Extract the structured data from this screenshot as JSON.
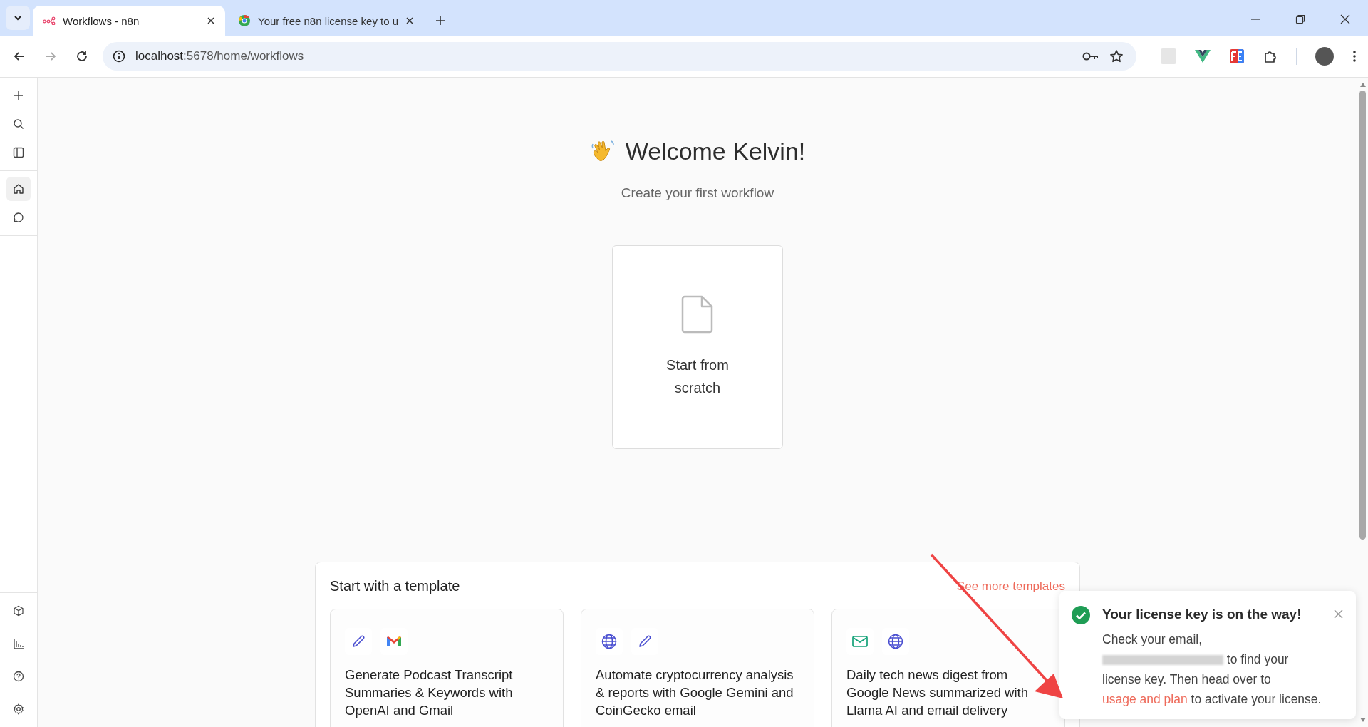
{
  "browser": {
    "tabs": [
      {
        "title": "Workflows - n8n",
        "selected": true,
        "kind": "n8n"
      },
      {
        "title": "Your free n8n license key to u",
        "selected": false,
        "kind": "chrome"
      }
    ],
    "address": "localhost:5678/home/workflows"
  },
  "sidebar": {
    "top": [
      {
        "kind": "plus",
        "selected": false
      },
      {
        "kind": "search",
        "selected": false
      },
      {
        "kind": "panel",
        "selected": false
      }
    ],
    "middle": [
      {
        "kind": "home",
        "selected": true
      },
      {
        "kind": "chat",
        "selected": false
      }
    ],
    "bottom": [
      {
        "kind": "box",
        "selected": false
      },
      {
        "kind": "chart",
        "selected": false
      },
      {
        "kind": "help",
        "selected": false
      },
      {
        "kind": "settings",
        "selected": false
      }
    ]
  },
  "welcome": {
    "title": "Welcome Kelvin!",
    "subtitle": "Create your first workflow"
  },
  "start_card": {
    "label": "Start from scratch"
  },
  "templates": {
    "heading": "Start with a template",
    "link": "See more templates",
    "cards": [
      {
        "icons": [
          {
            "kind": "pencil"
          },
          {
            "kind": "gmail"
          }
        ],
        "title": "Generate Podcast Transcript Summaries & Keywords with OpenAI and Gmail"
      },
      {
        "icons": [
          {
            "kind": "globe"
          },
          {
            "kind": "pencil"
          }
        ],
        "title": "Automate cryptocurrency analysis & reports with Google Gemini and CoinGecko email"
      },
      {
        "icons": [
          {
            "kind": "mail"
          },
          {
            "kind": "globe"
          }
        ],
        "title": "Daily tech news digest from Google News summarized with Llama AI and email delivery"
      }
    ]
  },
  "toast": {
    "title": "Your license key is on the way!",
    "text_before": "Check your email,",
    "text_after": "to find your license key. Then head over to",
    "link": "usage and plan",
    "text_end": "to activate your license."
  }
}
